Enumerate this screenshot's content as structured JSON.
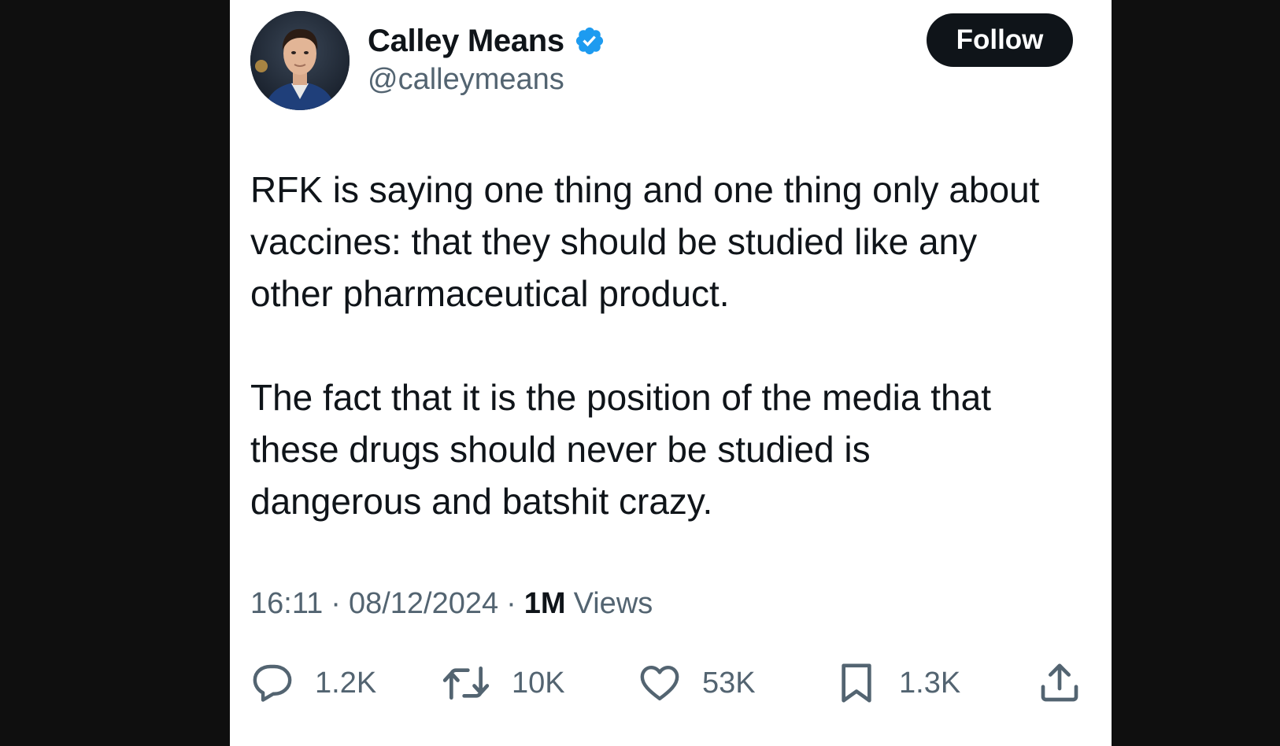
{
  "author": {
    "display_name": "Calley Means",
    "handle": "@calleymeans",
    "verified": true,
    "verified_color": "#1d9bf0"
  },
  "follow_button": {
    "label": "Follow"
  },
  "tweet": {
    "paragraphs": [
      "RFK is saying one thing and one thing only about\nvaccines: that they should be studied like any\nother pharmaceutical product.",
      "The fact that it is the position of the media that\nthese drugs should never be studied is\ndangerous and batshit crazy."
    ],
    "time": "16:11",
    "date": "08/12/2024",
    "separator": "·",
    "views_count": "1M",
    "views_label": "Views"
  },
  "actions": {
    "reply": {
      "icon": "reply-icon",
      "count": "1.2K"
    },
    "retweet": {
      "icon": "retweet-icon",
      "count": "10K"
    },
    "like": {
      "icon": "heart-icon",
      "count": "53K"
    },
    "bookmark": {
      "icon": "bookmark-icon",
      "count": "1.3K"
    },
    "share": {
      "icon": "share-icon"
    }
  },
  "colors": {
    "text_primary": "#0f1419",
    "text_secondary": "#536471",
    "background": "#ffffff",
    "page_background": "#0f0f0f"
  }
}
